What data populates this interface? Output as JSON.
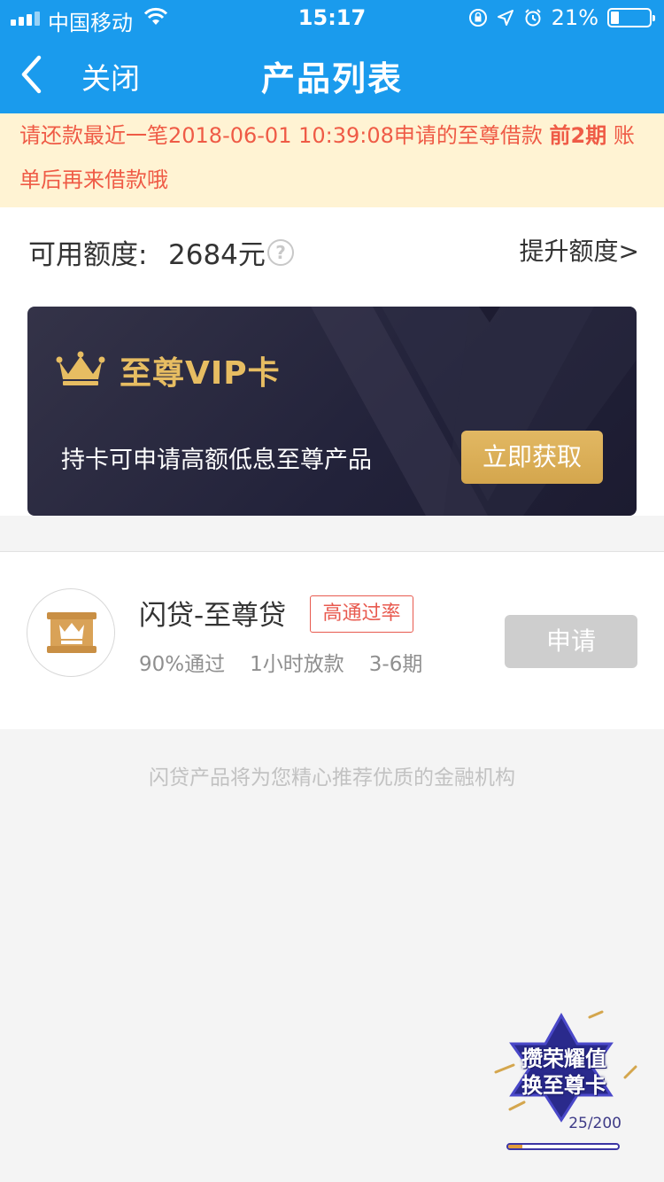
{
  "status_bar": {
    "carrier": "中国移动",
    "time": "15:17",
    "battery_percent": "21%",
    "battery_level": 0.21
  },
  "nav": {
    "back_label": "关闭",
    "title": "产品列表"
  },
  "notice": {
    "prefix": "请还款最近一笔2018-06-01 10:39:08申请的至尊借款",
    "highlight": "前2期",
    "suffix": " 账单后再来借款哦"
  },
  "credit": {
    "label": "可用额度:",
    "value": "2684元",
    "help_symbol": "?",
    "raise_link": "提升额度>"
  },
  "vip_card": {
    "title": "至尊VIP卡",
    "description": "持卡可申请高额低息至尊产品",
    "button": "立即获取",
    "accent_color": "#e7bd62"
  },
  "product": {
    "name": "闪贷-至尊贷",
    "tag": "高通过率",
    "stats": [
      "90%通过",
      "1小时放款",
      "3-6期"
    ],
    "apply_button": "申请",
    "logo_icon": "crown-seal-icon"
  },
  "footer_note": "闪贷产品将为您精心推荐优质的金融机构",
  "promo": {
    "text_line1": "攒荣耀值",
    "text_line2": "换至尊卡",
    "progress_text": "25/200",
    "progress": 0.125
  },
  "colors": {
    "brand_blue": "#1a9bed",
    "notice_bg": "#fff3d3",
    "notice_text": "#ef5b46",
    "gold": "#d4a64d"
  }
}
